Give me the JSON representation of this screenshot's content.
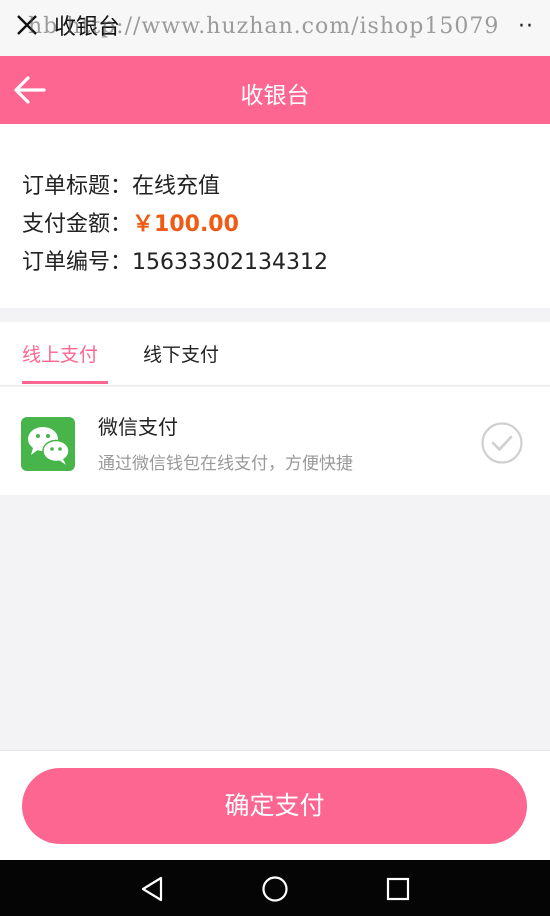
{
  "browser": {
    "title": "收银台",
    "watermark": "hb http://www.huzhan.com/ishop15079",
    "more": "··"
  },
  "header": {
    "title": "收银台"
  },
  "order": {
    "title_label": "订单标题：",
    "title_value": "在线充值",
    "amount_label": "支付金额：",
    "amount_value": "￥100.00",
    "number_label": "订单编号：",
    "number_value": "15633302134312"
  },
  "tabs": [
    {
      "label": "线上支付",
      "active": true
    },
    {
      "label": "线下支付",
      "active": false
    }
  ],
  "payment_method": {
    "name": "微信支付",
    "description": "通过微信钱包在线支付，方便快捷",
    "icon": "wechat-icon",
    "selected": true
  },
  "footer": {
    "confirm_label": "确定支付"
  },
  "colors": {
    "accent": "#fe6692",
    "amount": "#f05a12",
    "wechat": "#47b549"
  }
}
